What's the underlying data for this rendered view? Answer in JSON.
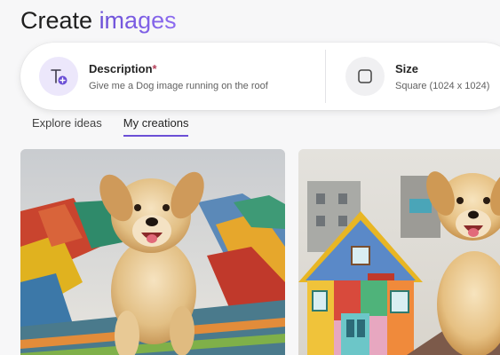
{
  "page": {
    "title_plain": "Create",
    "title_accent": "images"
  },
  "prompt": {
    "description_label": "Description",
    "required_marker": "*",
    "description_value": "Give me a Dog image running on the roof",
    "size_label": "Size",
    "size_value": "Square (1024 x 1024)"
  },
  "tabs": [
    {
      "label": "Explore ideas",
      "active": false
    },
    {
      "label": "My creations",
      "active": true
    }
  ],
  "colors": {
    "accent": "#6b4fd6",
    "required": "#b5405a"
  },
  "icons": {
    "description": "text-add-icon",
    "size": "square-icon"
  }
}
